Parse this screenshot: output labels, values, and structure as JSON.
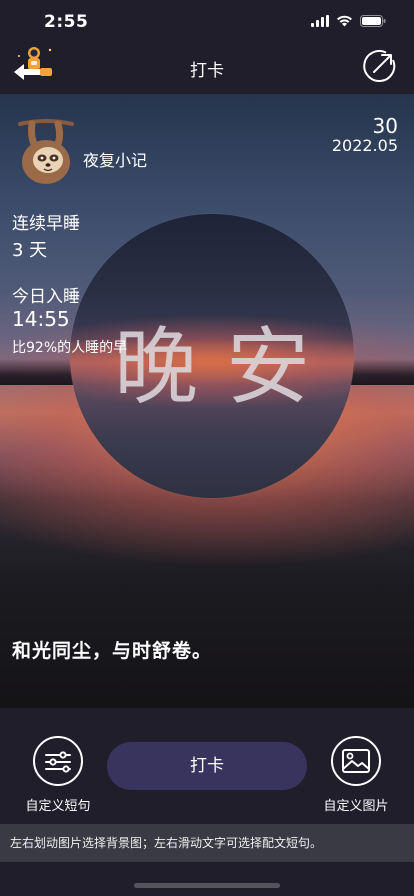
{
  "status_bar": {
    "time": "2:55"
  },
  "nav": {
    "title": "打卡"
  },
  "card": {
    "brand": "夜复小记",
    "day": "30",
    "month": "2022.05",
    "center_text": "晚安",
    "streak_label": "连续早睡",
    "streak_value": "3 天",
    "today_label": "今日入睡",
    "sleep_time": "14:55",
    "percent_text": "比92%的人睡的早",
    "quote": "和光同尘，与时舒卷。"
  },
  "bottom": {
    "custom_quote_label": "自定义短句",
    "punch_label": "打卡",
    "custom_image_label": "自定义图片",
    "hint": "左右划动图片选择背景图；左右滑动文字可选择配文短句。"
  },
  "icons": {
    "back": "astronaut-back-arrow-icon",
    "share": "share-arrow-icon",
    "sloth": "sloth-avatar-icon",
    "quote_settings": "sliders-icon",
    "image": "image-icon"
  }
}
